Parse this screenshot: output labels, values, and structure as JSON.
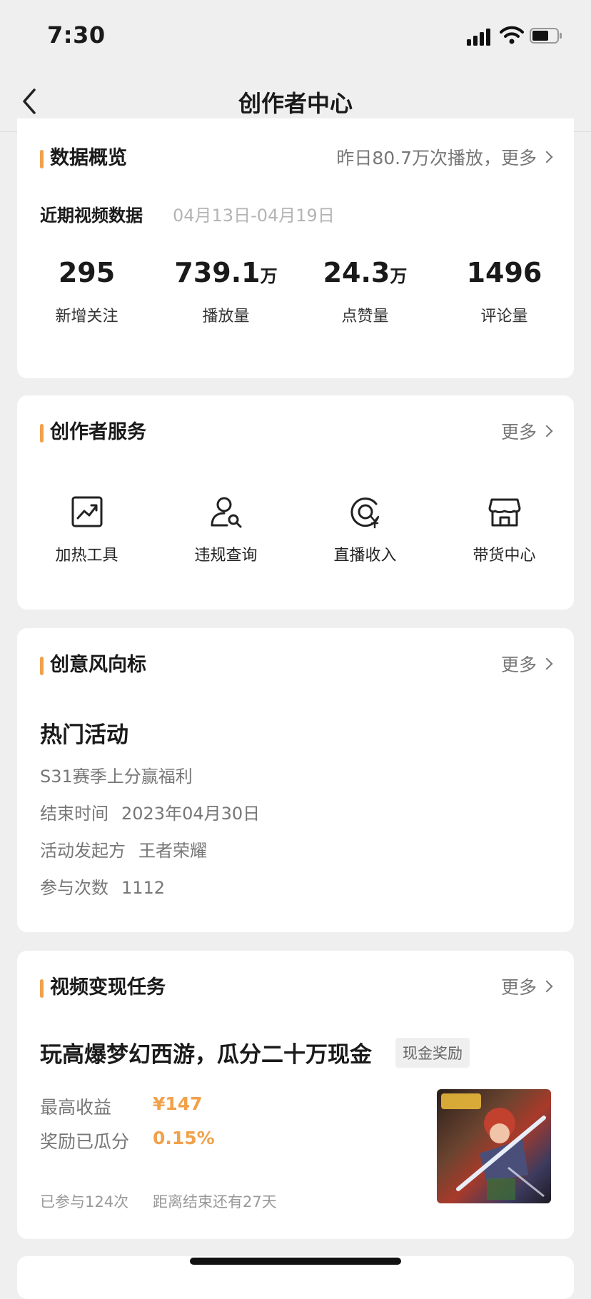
{
  "status_bar": {
    "time": "7:30"
  },
  "nav": {
    "title": "创作者中心"
  },
  "overview": {
    "title": "数据概览",
    "more": "昨日80.7万次播放，更多",
    "recent_label": "近期视频数据",
    "date_range": "04月13日-04月19日",
    "stats": [
      {
        "value": "295",
        "unit": "",
        "label": "新增关注"
      },
      {
        "value": "739.1",
        "unit": "万",
        "label": "播放量"
      },
      {
        "value": "24.3",
        "unit": "万",
        "label": "点赞量"
      },
      {
        "value": "1496",
        "unit": "",
        "label": "评论量"
      }
    ]
  },
  "services": {
    "title": "创作者服务",
    "more": "更多",
    "items": [
      {
        "label": "加热工具",
        "icon": "trend-chart-icon"
      },
      {
        "label": "违规查询",
        "icon": "user-search-icon"
      },
      {
        "label": "直播收入",
        "icon": "yuan-circle-icon"
      },
      {
        "label": "带货中心",
        "icon": "store-icon"
      }
    ]
  },
  "creative": {
    "title": "创意风向标",
    "more": "更多",
    "hot_title": "热门活动",
    "activity_name": "S31赛季上分赢福利",
    "end_label": "结束时间",
    "end_value": "2023年04月30日",
    "sponsor_label": "活动发起方",
    "sponsor_value": "王者荣耀",
    "count_label": "参与次数",
    "count_value": "1112"
  },
  "monetize": {
    "title": "视频变现任务",
    "more": "更多",
    "task_title": "玩高爆梦幻西游，瓜分二十万现金",
    "tag": "现金奖励",
    "max_income_label": "最高收益",
    "max_income_value": "¥147",
    "reward_label": "奖励已瓜分",
    "reward_value": "0.15%",
    "joined": "已参与124次",
    "remaining": "距离结束还有27天"
  },
  "colors": {
    "accent": "#f1a14a",
    "background": "#efefef",
    "card": "#ffffff"
  }
}
